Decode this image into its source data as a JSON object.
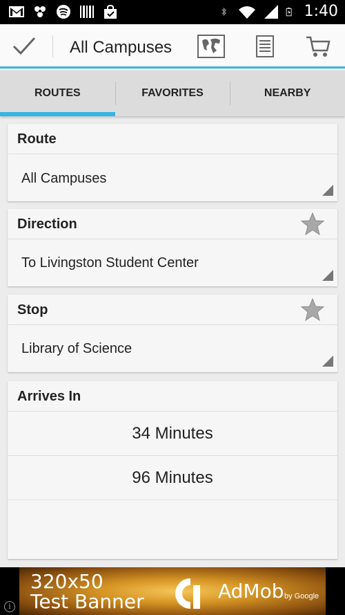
{
  "status_bar": {
    "time": "1:40",
    "left_icons": [
      "gmail-icon",
      "pinwheel-icon",
      "spotify-icon",
      "barcode-icon",
      "shopping-bag-icon"
    ],
    "right_icons": [
      "bluetooth-icon",
      "wifi-icon",
      "signal-icon",
      "battery-icon"
    ]
  },
  "action_bar": {
    "title": "All Campuses",
    "accent_color": "#33b5e5"
  },
  "tabs": [
    {
      "label": "ROUTES",
      "active": true
    },
    {
      "label": "FAVORITES",
      "active": false
    },
    {
      "label": "NEARBY",
      "active": false
    }
  ],
  "route": {
    "label": "Route",
    "value": "All Campuses"
  },
  "direction": {
    "label": "Direction",
    "value": "To Livingston Student Center"
  },
  "stop": {
    "label": "Stop",
    "value": "Library of Science"
  },
  "arrivals": {
    "label": "Arrives In",
    "times": [
      "34 Minutes",
      "96 Minutes"
    ]
  },
  "ad": {
    "line1": "320x50",
    "line2": "Test Banner",
    "brand": "AdMob",
    "by": "by Google",
    "info": "i"
  }
}
